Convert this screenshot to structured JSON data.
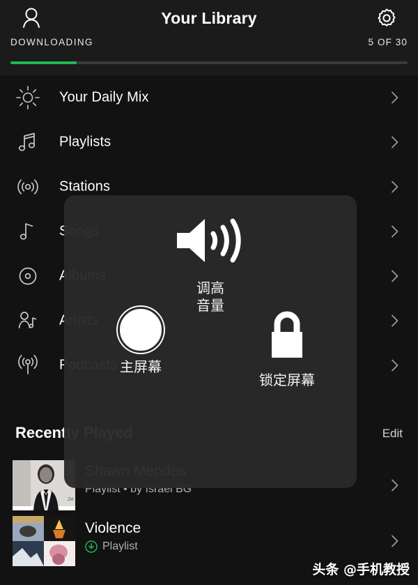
{
  "header": {
    "title": "Your Library",
    "profile_icon": "person-icon",
    "settings_icon": "gear-icon",
    "downloading_label": "DOWNLOADING",
    "downloading_count": "5 OF 30",
    "progress_percent": 16.7,
    "progress_fill_color": "#1db954",
    "progress_track_color": "#3a3a3a"
  },
  "library": {
    "items": [
      {
        "label": "Your Daily Mix",
        "icon": "sun-icon"
      },
      {
        "label": "Playlists",
        "icon": "double-music-note-icon"
      },
      {
        "label": "Stations",
        "icon": "radio-waves-icon"
      },
      {
        "label": "Songs",
        "icon": "music-note-icon"
      },
      {
        "label": "Albums",
        "icon": "disc-icon"
      },
      {
        "label": "Artists",
        "icon": "artist-icon"
      },
      {
        "label": "Podcasts",
        "icon": "broadcast-icon"
      }
    ]
  },
  "recent": {
    "title": "Recently Played",
    "edit_label": "Edit",
    "items": [
      {
        "name": "Shawn Mendes",
        "subtitle": "Playlist • by Israel BG",
        "downloaded": false,
        "artwork": "portrait-bw"
      },
      {
        "name": "Violence",
        "subtitle": "Playlist",
        "downloaded": true,
        "artwork": "album-grid"
      }
    ]
  },
  "assistive_touch": {
    "volume_up": {
      "label": "调高\n音量",
      "line1": "调高",
      "line2": "音量",
      "icon": "speaker-volume-icon"
    },
    "home": {
      "label": "主屏幕",
      "icon": "home-circle-icon"
    },
    "lock_screen": {
      "label": "锁定屏幕",
      "icon": "lock-icon"
    },
    "panel_color": "#2a2a2a"
  },
  "watermark": {
    "text": "头条 @手机教授"
  }
}
